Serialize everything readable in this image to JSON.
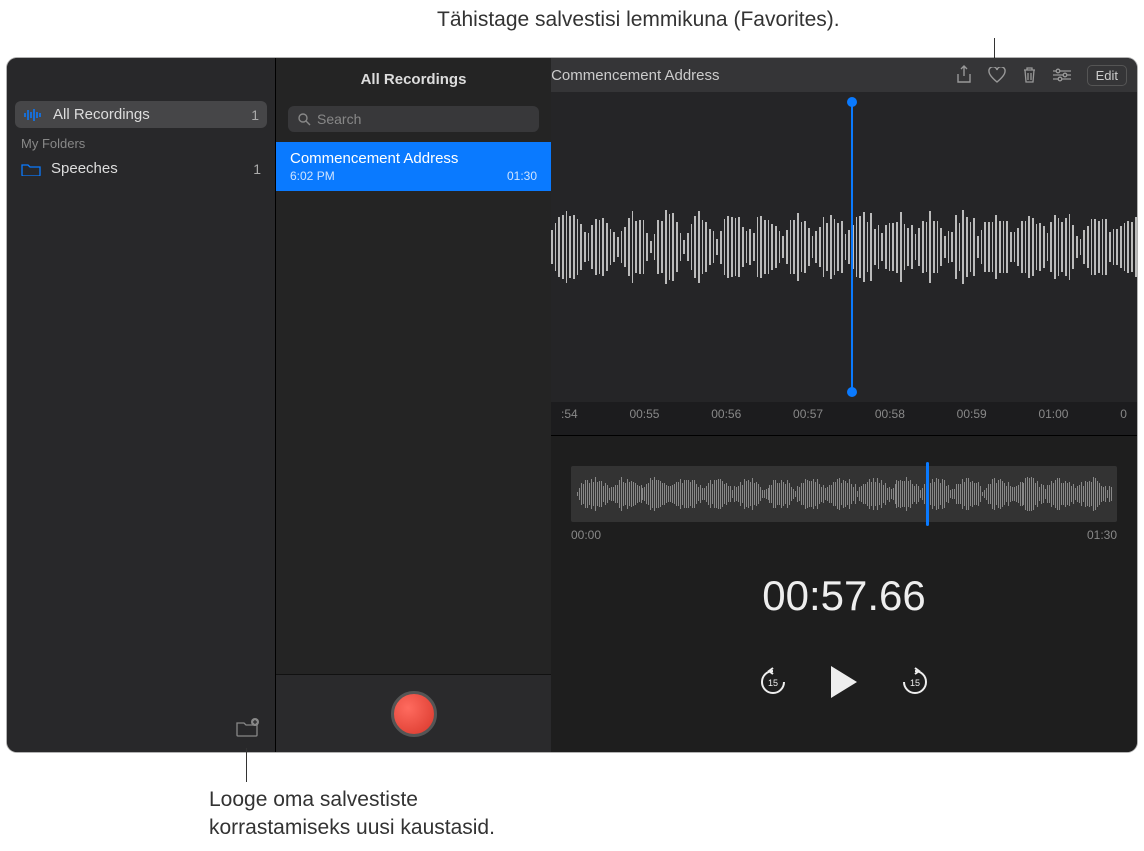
{
  "callouts": {
    "top": "Tähistage salvestisi lemmikuna (Favorites).",
    "bottom_l1": "Looge oma salvestiste",
    "bottom_l2": "korrastamiseks uusi kaustasid."
  },
  "sidebar": {
    "all_recordings": "All Recordings",
    "all_count": "1",
    "my_folders": "My Folders",
    "folders": [
      {
        "name": "Speeches",
        "count": "1"
      }
    ]
  },
  "list": {
    "header": "All Recordings",
    "search_placeholder": "Search",
    "items": [
      {
        "title": "Commencement Address",
        "time": "6:02 PM",
        "duration": "01:30"
      }
    ]
  },
  "toolbar": {
    "title": "Commencement Address",
    "edit": "Edit"
  },
  "ruler": {
    "ticks": [
      ":54",
      "00:55",
      "00:56",
      "00:57",
      "00:58",
      "00:59",
      "01:00",
      "0"
    ]
  },
  "overview": {
    "start": "00:00",
    "end": "01:30"
  },
  "time": "00:57.66",
  "icons": {
    "skip_back": "15",
    "skip_fwd": "15"
  }
}
